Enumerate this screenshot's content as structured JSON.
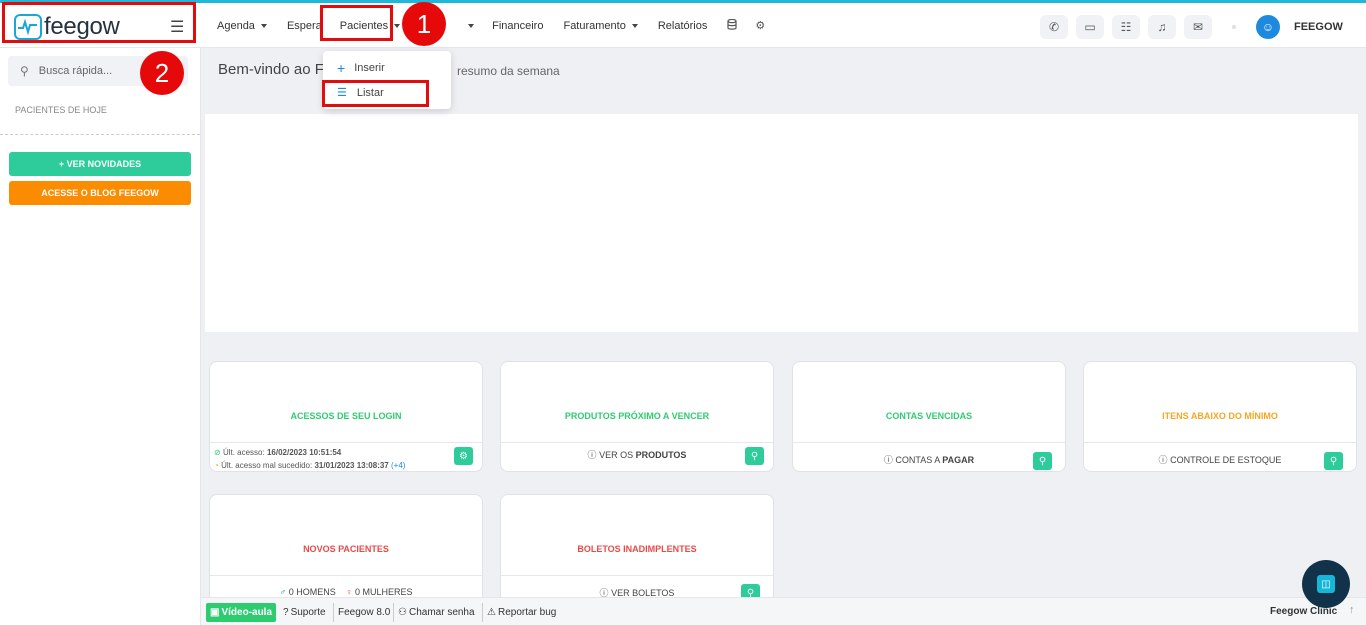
{
  "brand": {
    "name": "feegow"
  },
  "nav": {
    "items": [
      {
        "label": "Agenda",
        "caret": true
      },
      {
        "label": "Espera",
        "caret": false
      },
      {
        "label": "Pacientes",
        "caret": true
      },
      {
        "label": "",
        "caret": true
      },
      {
        "label": "Financeiro",
        "caret": false
      },
      {
        "label": "Faturamento",
        "caret": true
      },
      {
        "label": "Relatórios",
        "caret": false
      }
    ],
    "icons": [
      "database-icon",
      "gear-icon"
    ]
  },
  "user": {
    "name": "FEEGOW"
  },
  "annotations": {
    "one": "1",
    "two": "2"
  },
  "dropdown": {
    "inserir": "Inserir",
    "listar": "Listar"
  },
  "sidebar": {
    "search_placeholder": "Busca rápida...",
    "section": "PACIENTES DE HOJE",
    "btn_novidades": "+ VER NOVIDADES",
    "btn_blog": "ACESSE O BLOG FEEGOW"
  },
  "main": {
    "welcome": "Bem-vindo ao F",
    "welcome_sub": "resumo da semana"
  },
  "cards": {
    "acessos": {
      "title": "ACESSOS DE SEU LOGIN",
      "ult_label": "Últ. acesso:",
      "ult_value": "16/02/2023 10:51:54",
      "mal_label": "Últ. acesso mal sucedido:",
      "mal_value": "31/01/2023 13:08:37",
      "mal_extra": "(+4)"
    },
    "produtos": {
      "title": "PRODUTOS PRÓXIMO A VENCER",
      "foot_pre": "VER OS ",
      "foot_bold": "PRODUTOS"
    },
    "contas": {
      "title": "CONTAS VENCIDAS",
      "foot_pre": "CONTAS A ",
      "foot_bold": "PAGAR"
    },
    "itens": {
      "title": "ITENS ABAIXO DO MÍNIMO",
      "foot": "CONTROLE DE ESTOQUE"
    },
    "novos": {
      "title": "NOVOS PACIENTES",
      "homens": "0 HOMENS",
      "mulheres": "0 MULHERES"
    },
    "boletos": {
      "title": "BOLETOS INADIMPLENTES",
      "foot": "VER BOLETOS"
    }
  },
  "bottombar": {
    "video": "Vídeo-aula",
    "suporte": "Suporte",
    "version": "Feegow 8.0",
    "chamar": "Chamar senha",
    "bug": "Reportar bug",
    "clinic": "Feegow Clinic"
  },
  "colors": {
    "accent": "#1d8ae0",
    "green": "#2ecc9a",
    "orange": "#fb8c00",
    "red_title": "#e84a4a",
    "orange_title": "#f5a623",
    "highlight": "#e30b0b"
  }
}
